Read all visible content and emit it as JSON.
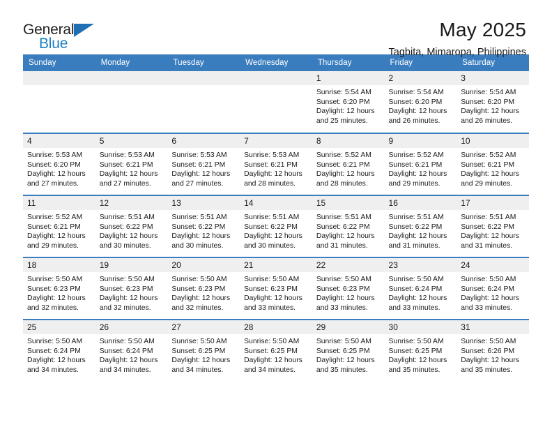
{
  "logo": {
    "word_top": "General",
    "word_bottom": "Blue",
    "triangle_color": "#1f6fb4",
    "text_color": "#231f20",
    "blue_color": "#1d7fc3"
  },
  "header": {
    "title": "May 2025",
    "subtitle": "Tagbita, Mimaropa, Philippines"
  },
  "theme": {
    "header_bg": "#3a7dbf",
    "header_text": "#ffffff",
    "daynum_bg": "#efefef",
    "cell_bg": "#ffffff",
    "body_text": "#1a1a1a"
  },
  "weekdays": [
    "Sunday",
    "Monday",
    "Tuesday",
    "Wednesday",
    "Thursday",
    "Friday",
    "Saturday"
  ],
  "weeks": [
    [
      {
        "day": "",
        "sunrise": "",
        "sunset": "",
        "daylight_1": "",
        "daylight_2": ""
      },
      {
        "day": "",
        "sunrise": "",
        "sunset": "",
        "daylight_1": "",
        "daylight_2": ""
      },
      {
        "day": "",
        "sunrise": "",
        "sunset": "",
        "daylight_1": "",
        "daylight_2": ""
      },
      {
        "day": "",
        "sunrise": "",
        "sunset": "",
        "daylight_1": "",
        "daylight_2": ""
      },
      {
        "day": "1",
        "sunrise": "Sunrise: 5:54 AM",
        "sunset": "Sunset: 6:20 PM",
        "daylight_1": "Daylight: 12 hours",
        "daylight_2": "and 25 minutes."
      },
      {
        "day": "2",
        "sunrise": "Sunrise: 5:54 AM",
        "sunset": "Sunset: 6:20 PM",
        "daylight_1": "Daylight: 12 hours",
        "daylight_2": "and 26 minutes."
      },
      {
        "day": "3",
        "sunrise": "Sunrise: 5:54 AM",
        "sunset": "Sunset: 6:20 PM",
        "daylight_1": "Daylight: 12 hours",
        "daylight_2": "and 26 minutes."
      }
    ],
    [
      {
        "day": "4",
        "sunrise": "Sunrise: 5:53 AM",
        "sunset": "Sunset: 6:20 PM",
        "daylight_1": "Daylight: 12 hours",
        "daylight_2": "and 27 minutes."
      },
      {
        "day": "5",
        "sunrise": "Sunrise: 5:53 AM",
        "sunset": "Sunset: 6:21 PM",
        "daylight_1": "Daylight: 12 hours",
        "daylight_2": "and 27 minutes."
      },
      {
        "day": "6",
        "sunrise": "Sunrise: 5:53 AM",
        "sunset": "Sunset: 6:21 PM",
        "daylight_1": "Daylight: 12 hours",
        "daylight_2": "and 27 minutes."
      },
      {
        "day": "7",
        "sunrise": "Sunrise: 5:53 AM",
        "sunset": "Sunset: 6:21 PM",
        "daylight_1": "Daylight: 12 hours",
        "daylight_2": "and 28 minutes."
      },
      {
        "day": "8",
        "sunrise": "Sunrise: 5:52 AM",
        "sunset": "Sunset: 6:21 PM",
        "daylight_1": "Daylight: 12 hours",
        "daylight_2": "and 28 minutes."
      },
      {
        "day": "9",
        "sunrise": "Sunrise: 5:52 AM",
        "sunset": "Sunset: 6:21 PM",
        "daylight_1": "Daylight: 12 hours",
        "daylight_2": "and 29 minutes."
      },
      {
        "day": "10",
        "sunrise": "Sunrise: 5:52 AM",
        "sunset": "Sunset: 6:21 PM",
        "daylight_1": "Daylight: 12 hours",
        "daylight_2": "and 29 minutes."
      }
    ],
    [
      {
        "day": "11",
        "sunrise": "Sunrise: 5:52 AM",
        "sunset": "Sunset: 6:21 PM",
        "daylight_1": "Daylight: 12 hours",
        "daylight_2": "and 29 minutes."
      },
      {
        "day": "12",
        "sunrise": "Sunrise: 5:51 AM",
        "sunset": "Sunset: 6:22 PM",
        "daylight_1": "Daylight: 12 hours",
        "daylight_2": "and 30 minutes."
      },
      {
        "day": "13",
        "sunrise": "Sunrise: 5:51 AM",
        "sunset": "Sunset: 6:22 PM",
        "daylight_1": "Daylight: 12 hours",
        "daylight_2": "and 30 minutes."
      },
      {
        "day": "14",
        "sunrise": "Sunrise: 5:51 AM",
        "sunset": "Sunset: 6:22 PM",
        "daylight_1": "Daylight: 12 hours",
        "daylight_2": "and 30 minutes."
      },
      {
        "day": "15",
        "sunrise": "Sunrise: 5:51 AM",
        "sunset": "Sunset: 6:22 PM",
        "daylight_1": "Daylight: 12 hours",
        "daylight_2": "and 31 minutes."
      },
      {
        "day": "16",
        "sunrise": "Sunrise: 5:51 AM",
        "sunset": "Sunset: 6:22 PM",
        "daylight_1": "Daylight: 12 hours",
        "daylight_2": "and 31 minutes."
      },
      {
        "day": "17",
        "sunrise": "Sunrise: 5:51 AM",
        "sunset": "Sunset: 6:22 PM",
        "daylight_1": "Daylight: 12 hours",
        "daylight_2": "and 31 minutes."
      }
    ],
    [
      {
        "day": "18",
        "sunrise": "Sunrise: 5:50 AM",
        "sunset": "Sunset: 6:23 PM",
        "daylight_1": "Daylight: 12 hours",
        "daylight_2": "and 32 minutes."
      },
      {
        "day": "19",
        "sunrise": "Sunrise: 5:50 AM",
        "sunset": "Sunset: 6:23 PM",
        "daylight_1": "Daylight: 12 hours",
        "daylight_2": "and 32 minutes."
      },
      {
        "day": "20",
        "sunrise": "Sunrise: 5:50 AM",
        "sunset": "Sunset: 6:23 PM",
        "daylight_1": "Daylight: 12 hours",
        "daylight_2": "and 32 minutes."
      },
      {
        "day": "21",
        "sunrise": "Sunrise: 5:50 AM",
        "sunset": "Sunset: 6:23 PM",
        "daylight_1": "Daylight: 12 hours",
        "daylight_2": "and 33 minutes."
      },
      {
        "day": "22",
        "sunrise": "Sunrise: 5:50 AM",
        "sunset": "Sunset: 6:23 PM",
        "daylight_1": "Daylight: 12 hours",
        "daylight_2": "and 33 minutes."
      },
      {
        "day": "23",
        "sunrise": "Sunrise: 5:50 AM",
        "sunset": "Sunset: 6:24 PM",
        "daylight_1": "Daylight: 12 hours",
        "daylight_2": "and 33 minutes."
      },
      {
        "day": "24",
        "sunrise": "Sunrise: 5:50 AM",
        "sunset": "Sunset: 6:24 PM",
        "daylight_1": "Daylight: 12 hours",
        "daylight_2": "and 33 minutes."
      }
    ],
    [
      {
        "day": "25",
        "sunrise": "Sunrise: 5:50 AM",
        "sunset": "Sunset: 6:24 PM",
        "daylight_1": "Daylight: 12 hours",
        "daylight_2": "and 34 minutes."
      },
      {
        "day": "26",
        "sunrise": "Sunrise: 5:50 AM",
        "sunset": "Sunset: 6:24 PM",
        "daylight_1": "Daylight: 12 hours",
        "daylight_2": "and 34 minutes."
      },
      {
        "day": "27",
        "sunrise": "Sunrise: 5:50 AM",
        "sunset": "Sunset: 6:25 PM",
        "daylight_1": "Daylight: 12 hours",
        "daylight_2": "and 34 minutes."
      },
      {
        "day": "28",
        "sunrise": "Sunrise: 5:50 AM",
        "sunset": "Sunset: 6:25 PM",
        "daylight_1": "Daylight: 12 hours",
        "daylight_2": "and 34 minutes."
      },
      {
        "day": "29",
        "sunrise": "Sunrise: 5:50 AM",
        "sunset": "Sunset: 6:25 PM",
        "daylight_1": "Daylight: 12 hours",
        "daylight_2": "and 35 minutes."
      },
      {
        "day": "30",
        "sunrise": "Sunrise: 5:50 AM",
        "sunset": "Sunset: 6:25 PM",
        "daylight_1": "Daylight: 12 hours",
        "daylight_2": "and 35 minutes."
      },
      {
        "day": "31",
        "sunrise": "Sunrise: 5:50 AM",
        "sunset": "Sunset: 6:26 PM",
        "daylight_1": "Daylight: 12 hours",
        "daylight_2": "and 35 minutes."
      }
    ]
  ]
}
